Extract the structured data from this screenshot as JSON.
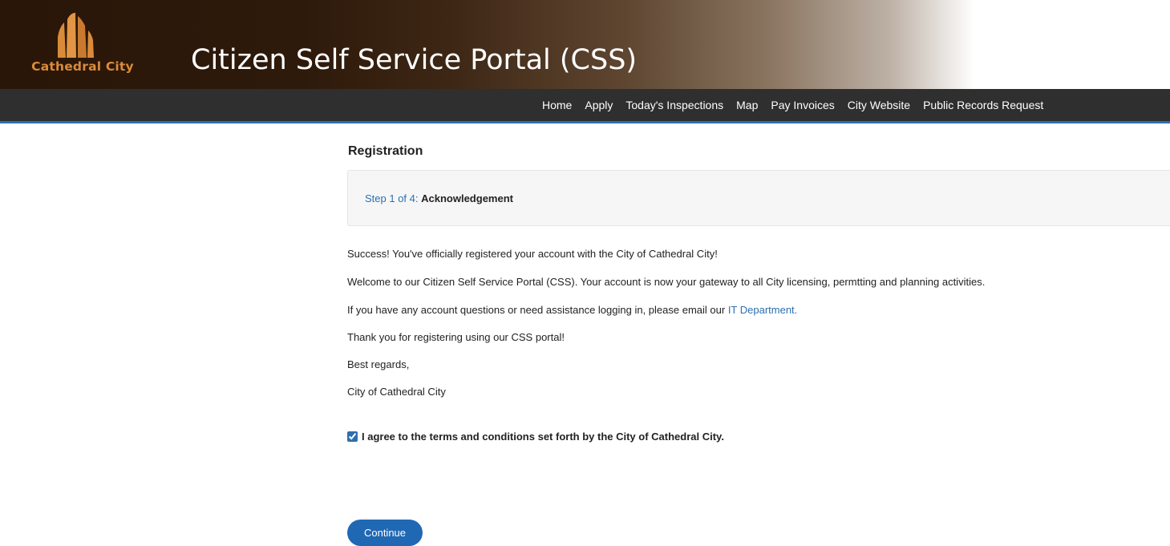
{
  "header": {
    "logo_text": "Cathedral City",
    "site_title": "Citizen Self Service Portal (CSS)"
  },
  "nav": {
    "items": [
      {
        "label": "Home"
      },
      {
        "label": "Apply"
      },
      {
        "label": "Today's Inspections"
      },
      {
        "label": "Map"
      },
      {
        "label": "Pay Invoices"
      },
      {
        "label": "City Website"
      },
      {
        "label": "Public Records Request"
      }
    ]
  },
  "registration": {
    "title": "Registration",
    "step_label": "Step 1 of 4:",
    "step_name": "Acknowledgement",
    "messages": [
      "Success! You've officially registered your account with the City of Cathedral City!",
      "Welcome to our Citizen Self Service Portal (CSS). Your account is now your gateway to all City licensing, permtting and planning activities."
    ],
    "help_text": "If you have any account questions or need assistance logging in, please email our ",
    "help_link": "IT Department.",
    "closing": [
      "Thank you for registering using our CSS portal!",
      "Best regards,",
      "City of Cathedral City"
    ],
    "agree_label": "I agree to the terms and conditions set forth by the City of Cathedral City.",
    "agree_checked": true,
    "continue_label": "Continue"
  },
  "colors": {
    "accent": "#2d6fb0",
    "button": "#2068b4",
    "nav_bg": "#2f2f2f",
    "logo_orange": "#d98b3a"
  },
  "icons": {
    "logo": "cathedral-spires-logo-icon"
  }
}
